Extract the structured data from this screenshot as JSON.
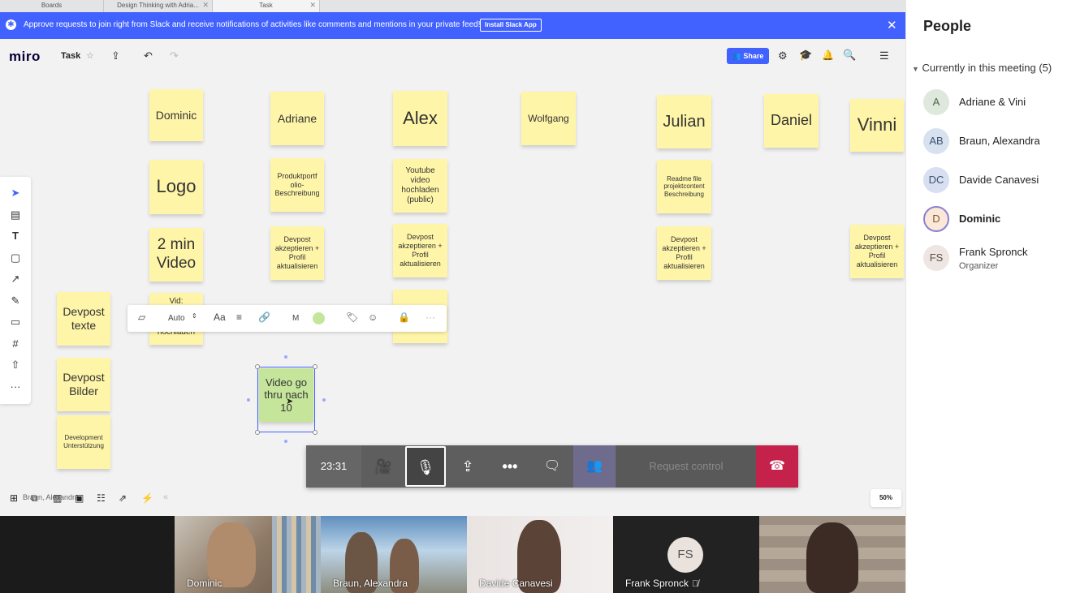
{
  "browser_tabs": [
    {
      "label": "Boards"
    },
    {
      "label": "Design Thinking with Adria..."
    },
    {
      "label": "Task"
    }
  ],
  "banner": {
    "message": "Approve requests to join right from Slack and receive notifications of activities like comments and mentions in your private feed!",
    "button": "Install Slack App"
  },
  "toolbar": {
    "logo": "miro",
    "board_name": "Task",
    "share": "Share"
  },
  "notes": {
    "dominic": "Dominic",
    "adriane": "Adriane",
    "alex": "Alex",
    "wolfgang": "Wolfgang",
    "julian": "Julian",
    "daniel": "Daniel",
    "vinni": "Vinni",
    "logo": "Logo",
    "produktportfolio": "Produktportf olio-Beschreibung",
    "youtube": "Youtube video hochladen (public)",
    "readme": "Readme file projektcontent Beschreibung",
    "video2min": "2 min Video",
    "devpost_adriane": "Devpost akzeptieren + Profil aktualisieren",
    "devpost_alex": "Devpost akzeptieren + Profil aktualisieren",
    "devpost_julian": "Devpost akzeptieren + Profil aktualisieren",
    "devpost_vinni": "Devpost akzeptieren + Profil aktualisieren",
    "vid_top": "Vid:",
    "vid_bottom": "hochladen",
    "devpost_texte": "Devpost texte",
    "devpost_bilder": "Devpost Bilder",
    "development": "Development Unterstützung",
    "selected": "Video go thru nach 10"
  },
  "context_toolbar": {
    "size": "Auto",
    "font": "Aa",
    "author": "M",
    "more": "···",
    "note_color": "#c5e59b"
  },
  "call": {
    "timer": "23:31",
    "request_control": "Request control"
  },
  "zoom": "50%",
  "bottom_hint": "Braun, Alexandra",
  "videos": [
    {
      "name": "Dominic"
    },
    {
      "name": "Braun, Alexandra"
    },
    {
      "name": "Davide Canavesi"
    },
    {
      "name": "Frank Spronck",
      "initials": "FS"
    },
    {
      "name": ""
    }
  ],
  "people": {
    "title": "People",
    "section": "Currently in this meeting (5)",
    "list": [
      {
        "initials": "A",
        "name": "Adriane & Vini",
        "color": "#dfe8dc"
      },
      {
        "initials": "AB",
        "name": "Braun, Alexandra",
        "color": "#d8e1ef"
      },
      {
        "initials": "DC",
        "name": "Davide Canavesi",
        "color": "#d7dff0"
      },
      {
        "initials": "D",
        "name": "Dominic",
        "color": "#fbe8d6"
      },
      {
        "initials": "FS",
        "name": "Frank Spronck",
        "role": "Organizer",
        "color": "#ede6e2"
      }
    ]
  }
}
